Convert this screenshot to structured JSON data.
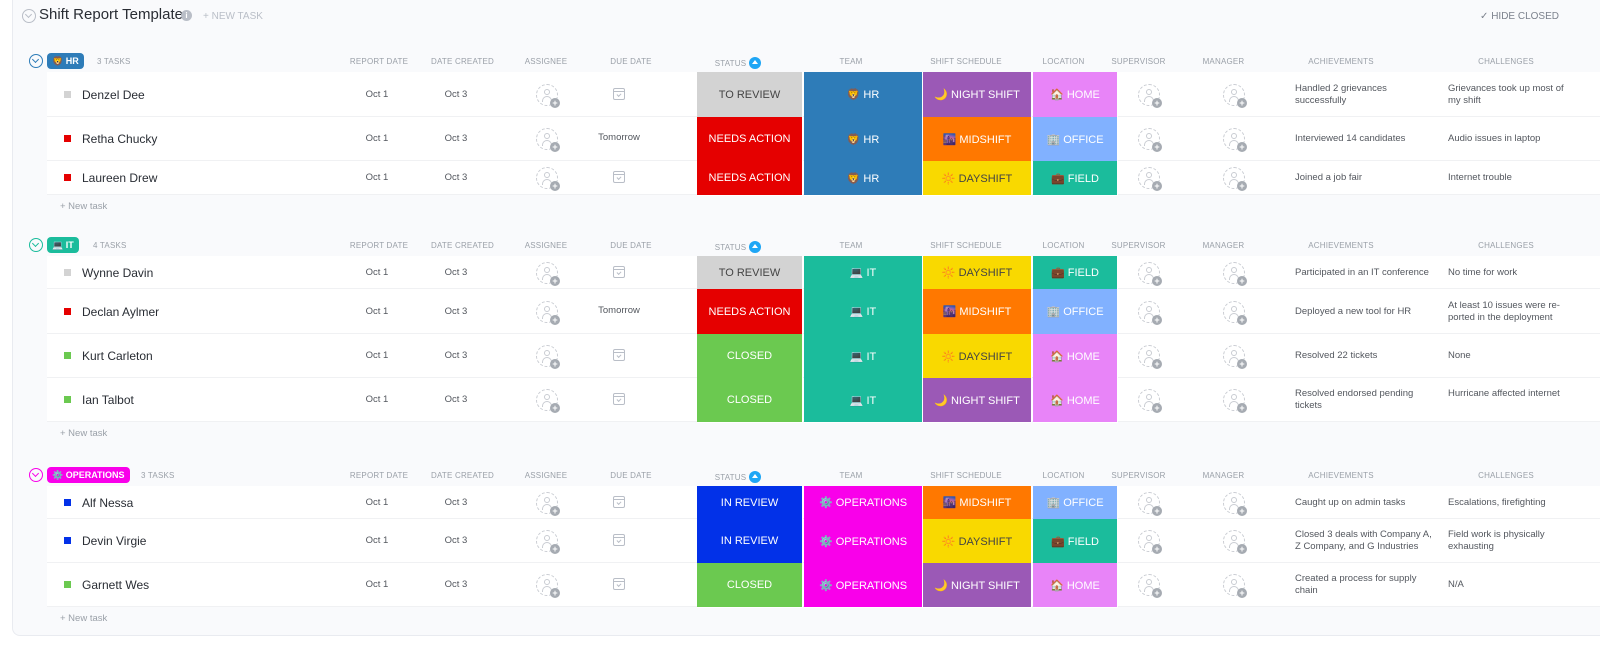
{
  "header": {
    "title": "Shift Report Template",
    "new_task": "+ NEW TASK",
    "hide_closed": "✓ HIDE CLOSED"
  },
  "columns": {
    "report_date": "REPORT DATE",
    "date_created": "DATE CREATED",
    "assignee": "ASSIGNEE",
    "due_date": "DUE DATE",
    "status": "STATUS",
    "team": "TEAM",
    "shift_schedule": "SHIFT SCHEDULE",
    "location": "LOCATION",
    "supervisor": "SUPERVISOR",
    "manager": "MANAGER",
    "achievements": "ACHIEVEMENTS",
    "challenges": "CHALLENGES"
  },
  "new_task_label": "+ New task",
  "colors": {
    "to_review": "#d3d3d3",
    "needs_action": "#e50000",
    "closed": "#6bc950",
    "in_review": "#0231e8",
    "team_hr": "#2e7cb8",
    "team_it": "#1bbc9c",
    "team_ops": "#f900ea",
    "night_shift": "#9b59b6",
    "midshift": "#ff7800",
    "dayshift": "#f9d900",
    "home": "#e884f8",
    "office": "#81b1ff",
    "field": "#1bbc9c"
  },
  "groups": [
    {
      "badge": "🦁 HR",
      "badge_color": "#2e7cb8",
      "count": "3 TASKS",
      "tasks": [
        {
          "name": "Denzel Dee",
          "square": "#d3d3d3",
          "report_date": "Oct 1",
          "date_created": "Oct 3",
          "due_date": "",
          "status": "TO REVIEW",
          "status_color": "#d3d3d3",
          "team": "🦁 HR",
          "team_color": "#2e7cb8",
          "shift": "🌙 NIGHT SHIFT",
          "shift_color": "#9b59b6",
          "location": "🏠 HOME",
          "location_color": "#e884f8",
          "achievements": "Handled 2 grievances successfully",
          "challenges": "Grievances took up most of my shift"
        },
        {
          "name": "Retha Chucky",
          "square": "#e50000",
          "report_date": "Oct 1",
          "date_created": "Oct 3",
          "due_date": "Tomorrow",
          "status": "NEEDS ACTION",
          "status_color": "#e50000",
          "team": "🦁 HR",
          "team_color": "#2e7cb8",
          "shift": "🌆 MIDSHIFT",
          "shift_color": "#ff7800",
          "location": "🏢 OFFICE",
          "location_color": "#81b1ff",
          "achievements": "Interviewed 14 candidates",
          "challenges": "Audio issues in laptop"
        },
        {
          "name": "Laureen Drew",
          "square": "#e50000",
          "report_date": "Oct 1",
          "date_created": "Oct 3",
          "due_date": "",
          "status": "NEEDS ACTION",
          "status_color": "#e50000",
          "team": "🦁 HR",
          "team_color": "#2e7cb8",
          "shift": "🔆 DAYSHIFT",
          "shift_color": "#f9d900",
          "location": "💼 FIELD",
          "location_color": "#1bbc9c",
          "achievements": "Joined a job fair",
          "challenges": "Internet trouble"
        }
      ]
    },
    {
      "badge": "💻 IT",
      "badge_color": "#1bbc9c",
      "count": "4 TASKS",
      "tasks": [
        {
          "name": "Wynne Davin",
          "square": "#d3d3d3",
          "report_date": "Oct 1",
          "date_created": "Oct 3",
          "due_date": "",
          "status": "TO REVIEW",
          "status_color": "#d3d3d3",
          "team": "💻 IT",
          "team_color": "#1bbc9c",
          "shift": "🔆 DAYSHIFT",
          "shift_color": "#f9d900",
          "location": "💼 FIELD",
          "location_color": "#1bbc9c",
          "achievements": "Participated in an IT conference",
          "challenges": "No time for work"
        },
        {
          "name": "Declan Aylmer",
          "square": "#e50000",
          "report_date": "Oct 1",
          "date_created": "Oct 3",
          "due_date": "Tomorrow",
          "status": "NEEDS ACTION",
          "status_color": "#e50000",
          "team": "💻 IT",
          "team_color": "#1bbc9c",
          "shift": "🌆 MIDSHIFT",
          "shift_color": "#ff7800",
          "location": "🏢 OFFICE",
          "location_color": "#81b1ff",
          "achievements": "Deployed a new tool for HR",
          "challenges": "At least 10 issues were re-ported in the deployment"
        },
        {
          "name": "Kurt Carleton",
          "square": "#6bc950",
          "report_date": "Oct 1",
          "date_created": "Oct 3",
          "due_date": "",
          "status": "CLOSED",
          "status_color": "#6bc950",
          "team": "💻 IT",
          "team_color": "#1bbc9c",
          "shift": "🔆 DAYSHIFT",
          "shift_color": "#f9d900",
          "location": "🏠 HOME",
          "location_color": "#e884f8",
          "achievements": "Resolved 22 tickets",
          "challenges": "None"
        },
        {
          "name": "Ian Talbot",
          "square": "#6bc950",
          "report_date": "Oct 1",
          "date_created": "Oct 3",
          "due_date": "",
          "status": "CLOSED",
          "status_color": "#6bc950",
          "team": "💻 IT",
          "team_color": "#1bbc9c",
          "shift": "🌙 NIGHT SHIFT",
          "shift_color": "#9b59b6",
          "location": "🏠 HOME",
          "location_color": "#e884f8",
          "achievements": "Resolved endorsed pending tickets",
          "challenges": "Hurricane affected internet"
        }
      ]
    },
    {
      "badge": "⚙️ OPERATIONS",
      "badge_color": "#f900ea",
      "count": "3 TASKS",
      "tasks": [
        {
          "name": "Alf Nessa",
          "square": "#0231e8",
          "report_date": "Oct 1",
          "date_created": "Oct 3",
          "due_date": "",
          "status": "IN REVIEW",
          "status_color": "#0231e8",
          "team": "⚙️ OPERATIONS",
          "team_color": "#f900ea",
          "shift": "🌆 MIDSHIFT",
          "shift_color": "#ff7800",
          "location": "🏢 OFFICE",
          "location_color": "#81b1ff",
          "achievements": "Caught up on admin tasks",
          "challenges": "Escalations, firefighting"
        },
        {
          "name": "Devin Virgie",
          "square": "#0231e8",
          "report_date": "Oct 1",
          "date_created": "Oct 3",
          "due_date": "",
          "status": "IN REVIEW",
          "status_color": "#0231e8",
          "team": "⚙️ OPERATIONS",
          "team_color": "#f900ea",
          "shift": "🔆 DAYSHIFT",
          "shift_color": "#f9d900",
          "location": "💼 FIELD",
          "location_color": "#1bbc9c",
          "achievements": "Closed 3 deals with Company A, Z Company, and G Industries",
          "challenges": "Field work is physically exhausting"
        },
        {
          "name": "Garnett Wes",
          "square": "#6bc950",
          "report_date": "Oct 1",
          "date_created": "Oct 3",
          "due_date": "",
          "status": "CLOSED",
          "status_color": "#6bc950",
          "team": "⚙️ OPERATIONS",
          "team_color": "#f900ea",
          "shift": "🌙 NIGHT SHIFT",
          "shift_color": "#9b59b6",
          "location": "🏠 HOME",
          "location_color": "#e884f8",
          "achievements": "Created a process for supply chain",
          "challenges": "N/A"
        }
      ]
    }
  ]
}
